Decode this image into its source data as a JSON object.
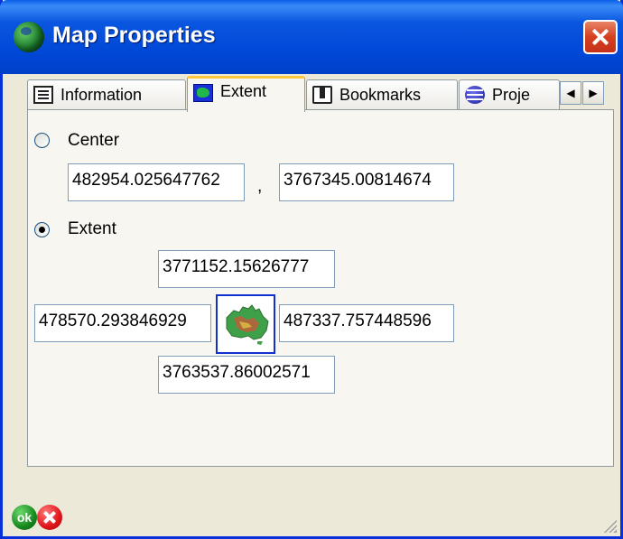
{
  "window": {
    "title": "Map Properties"
  },
  "tabs": [
    {
      "label": "Information",
      "icon": "info-list-icon"
    },
    {
      "label": "Extent",
      "icon": "map-extent-icon",
      "active": true
    },
    {
      "label": "Bookmarks",
      "icon": "bookmarks-icon"
    },
    {
      "label": "Proje",
      "icon": "globe-icon"
    }
  ],
  "tab_scroll": {
    "left": "◀",
    "right": "▶"
  },
  "center": {
    "label": "Center",
    "selected": false,
    "x": "482954.025647762",
    "separator": ",",
    "y": "3767345.00814674"
  },
  "extent": {
    "label": "Extent",
    "selected": true,
    "north": "3771152.15626777",
    "west": "478570.293846929",
    "east": "487337.757448596",
    "south": "3763537.86002571"
  },
  "footer": {
    "ok_label": "ok",
    "cancel_icon": "cancel-icon"
  },
  "colors": {
    "titlebar": "#0a56e0",
    "panel": "#f7f6f0",
    "field_border": "#7f9db9",
    "active_tab_accent": "#ffc83c"
  }
}
